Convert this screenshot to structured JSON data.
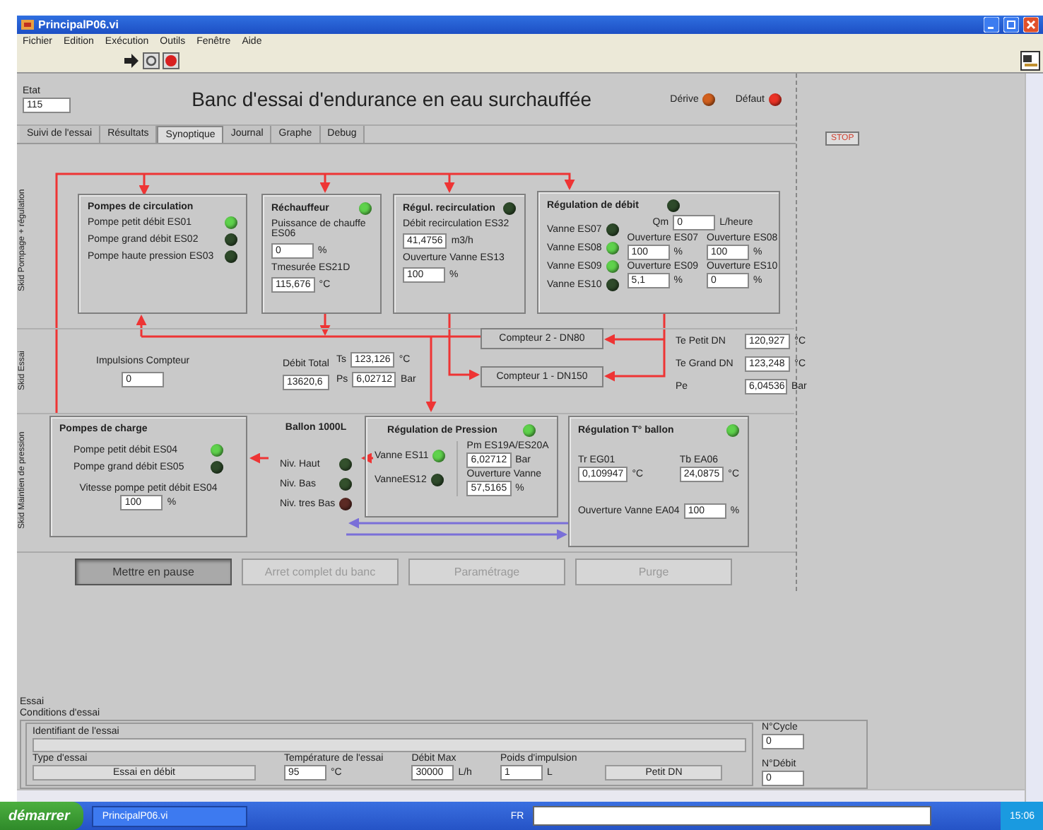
{
  "window": {
    "title": "PrincipalP06.vi"
  },
  "menu": [
    "Fichier",
    "Edition",
    "Exécution",
    "Outils",
    "Fenêtre",
    "Aide"
  ],
  "header": {
    "etat_label": "Etat",
    "etat_value": "115",
    "title": "Banc d'essai d'endurance en eau surchauffée",
    "indicators": [
      {
        "label": "Dérive",
        "color": "#d2601e"
      },
      {
        "label": "Défaut",
        "color": "#ea3326"
      }
    ]
  },
  "stop_button": "STOP",
  "tabs": [
    {
      "label": "Suivi de l'essai",
      "selected": false
    },
    {
      "label": "Résultats",
      "selected": false
    },
    {
      "label": "Synoptique",
      "selected": true
    },
    {
      "label": "Journal",
      "selected": false
    },
    {
      "label": "Graphe",
      "selected": false
    },
    {
      "label": "Debug",
      "selected": false
    }
  ],
  "skids": [
    "Skid Pompage + régulation",
    "Skid Essai",
    "Skid Maintien de pression"
  ],
  "circulation": {
    "title": "Pompes de circulation",
    "pumps": [
      {
        "label": "Pompe petit débit ES01",
        "on": true
      },
      {
        "label": "Pompe grand débit ES02",
        "on": false
      },
      {
        "label": "Pompe haute pression ES03",
        "on": false
      }
    ]
  },
  "rechauffeur": {
    "title": "Réchauffeur",
    "on": true,
    "fields": [
      {
        "label": "Puissance de chauffe ES06",
        "value": "0",
        "unit": "%"
      },
      {
        "label": "Tmesurée ES21D",
        "value": "115,676",
        "unit": "°C"
      }
    ]
  },
  "recirculation": {
    "title": "Régul. recirculation",
    "on": false,
    "fields": [
      {
        "label": "Débit recirculation ES32",
        "value": "41,4756",
        "unit": "m3/h"
      },
      {
        "label": "Ouverture Vanne ES13",
        "value": "100",
        "unit": "%"
      }
    ]
  },
  "regulation_debit": {
    "title": "Régulation de débit",
    "on": false,
    "valves": [
      {
        "label": "Vanne ES07",
        "on": false
      },
      {
        "label": "Vanne ES08",
        "on": true
      },
      {
        "label": "Vanne ES09",
        "on": true
      },
      {
        "label": "Vanne ES10",
        "on": false
      }
    ],
    "qm": {
      "label": "Qm",
      "value": "0",
      "unit": "L/heure"
    },
    "openings": [
      {
        "label": "Ouverture ES07",
        "value": "100",
        "unit": "%"
      },
      {
        "label": "Ouverture ES08",
        "value": "100",
        "unit": "%"
      },
      {
        "label": "Ouverture ES09",
        "value": "5,1",
        "unit": "%"
      },
      {
        "label": "Ouverture ES10",
        "value": "0",
        "unit": "%"
      }
    ]
  },
  "counters": [
    "Compteur 2 - DN80",
    "Compteur 1 - DN150"
  ],
  "essai": {
    "impulsions": {
      "label": "Impulsions Compteur",
      "value": "0"
    },
    "debit_total": {
      "label": "Débit Total",
      "value": "13620,6"
    },
    "readings": [
      {
        "label": "Ts",
        "value": "123,126",
        "unit": "°C"
      },
      {
        "label": "Ps",
        "value": "6,02712",
        "unit": "Bar"
      }
    ],
    "inlet": [
      {
        "label": "Te Petit DN",
        "value": "120,927",
        "unit": "°C"
      },
      {
        "label": "Te Grand DN",
        "value": "123,248",
        "unit": "°C"
      },
      {
        "label": "Pe",
        "value": "6,04536",
        "unit": "Bar"
      }
    ]
  },
  "charge": {
    "title": "Pompes de charge",
    "pumps": [
      {
        "label": "Pompe petit débit ES04",
        "on": true
      },
      {
        "label": "Pompe grand débit ES05",
        "on": false
      }
    ],
    "speed": {
      "label": "Vitesse pompe petit débit ES04",
      "value": "100",
      "unit": "%"
    }
  },
  "ballon": {
    "title": "Ballon 1000L",
    "levels": [
      {
        "label": "Niv. Haut",
        "color": "#33502c"
      },
      {
        "label": "Niv. Bas",
        "color": "#33502c"
      },
      {
        "label": "Niv. tres Bas",
        "color": "#5c2a24"
      }
    ]
  },
  "pression": {
    "title": "Régulation de Pression",
    "on": true,
    "valves": [
      {
        "label": "Vanne ES11",
        "on": true
      },
      {
        "label": "VanneES12",
        "on": false
      }
    ],
    "fields": [
      {
        "label": "Pm ES19A/ES20A",
        "value": "6,02712",
        "unit": "Bar"
      },
      {
        "label": "Ouverture Vanne",
        "value": "57,5165",
        "unit": "%"
      }
    ]
  },
  "t_ballon": {
    "title": "Régulation T° ballon",
    "on": true,
    "fields": [
      {
        "label": "Tr EG01",
        "value": "0,109947",
        "unit": "°C"
      },
      {
        "label": "Tb EA06",
        "value": "24,0875",
        "unit": "°C"
      }
    ],
    "opening": {
      "label": "Ouverture Vanne EA04",
      "value": "100",
      "unit": "%"
    }
  },
  "buttons": [
    {
      "label": "Mettre en pause",
      "pressed": true,
      "disabled": false
    },
    {
      "label": "Arret complet du banc",
      "pressed": false,
      "disabled": true
    },
    {
      "label": "Paramétrage",
      "pressed": false,
      "disabled": true
    },
    {
      "label": "Purge",
      "pressed": false,
      "disabled": true
    }
  ],
  "test": {
    "section": "Essai",
    "group": "Conditions d'essai",
    "identifier": {
      "label": "Identifiant de l'essai"
    },
    "type": {
      "label": "Type d'essai",
      "value": "Essai en débit"
    },
    "temperature": {
      "label": "Température de l'essai",
      "value": "95",
      "unit": "°C"
    },
    "debit_max": {
      "label": "Débit Max",
      "value": "30000",
      "unit": "L/h"
    },
    "poids": {
      "label": "Poids d'impulsion",
      "value": "1",
      "unit": "L"
    },
    "dn": {
      "value": "Petit DN"
    },
    "cycle": {
      "label": "N°Cycle",
      "value": "0"
    },
    "debit_no": {
      "label": "N°Débit",
      "value": "0"
    }
  },
  "taskbar": {
    "start": "démarrer",
    "task": "PrincipalP06.vi",
    "lang": "FR",
    "clock": "15:06"
  }
}
